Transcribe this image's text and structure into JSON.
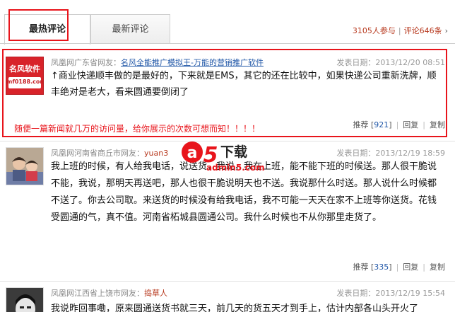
{
  "tabs": [
    {
      "label": "最热评论"
    },
    {
      "label": "最新评论"
    }
  ],
  "stats": {
    "participants": "3105人参与",
    "separator": "|",
    "comments": "评论646条",
    "close": "›"
  },
  "comments": [
    {
      "source": "凤凰网广东省网友：",
      "user": "名风全能推广模拟王-万能的营销推广软件",
      "date": "发表日期：2013/12/20 08:51",
      "text": "↑商业快递顺丰做的是最好的，下来就是EMS，其它的还在比较中，如果快递公司重新洗牌，顺丰绝对是老大，看来圆通要倒闭了",
      "recommend": "推荐",
      "count": "921",
      "reply": "回复",
      "copy": "复制",
      "avatar_text": "名风软件",
      "avatar_sub": "mf0188.com"
    },
    {
      "source": "凤凰网河南省商丘市网友：",
      "user": "yuan3",
      "date": "发表日期：2013/12/19 18:59",
      "text": "我上班的时候，有人给我电话，说送货，我说，我在上班，能不能下班的时候送。那人很干脆说不能，我说，那明天再送吧，那人也很干脆说明天也不送。我说那什么时送。那人说什么时候都不送了。你去公司取。来送货的时候没有给我电话，我不可能一天天在家不上班等你送货。花钱受圆通的气，真不值。河南省柘城县圆通公司。我什么时候也不从你那里走货了。",
      "recommend": "推荐",
      "count": "335",
      "reply": "回复",
      "copy": "复制"
    },
    {
      "source": "凤凰网江西省上饶市网友：",
      "user": "捣草人",
      "date": "发表日期：2013/12/19 15:54",
      "text": "我说昨回事嘞，原来圆通送货书就三天，前几天的货五天才到手上，估计内部各山头开火了"
    }
  ],
  "promo_text": "随便一篇新闻就几万的访问量，给你展示的次数可想而知！！！！",
  "watermark": {
    "letter": "a",
    "digit": "5",
    "word": "下载",
    "site": "admin5.com"
  },
  "colors": {
    "highlight": "#e8141b",
    "link": "#2258a8",
    "username": "#b7381d"
  }
}
